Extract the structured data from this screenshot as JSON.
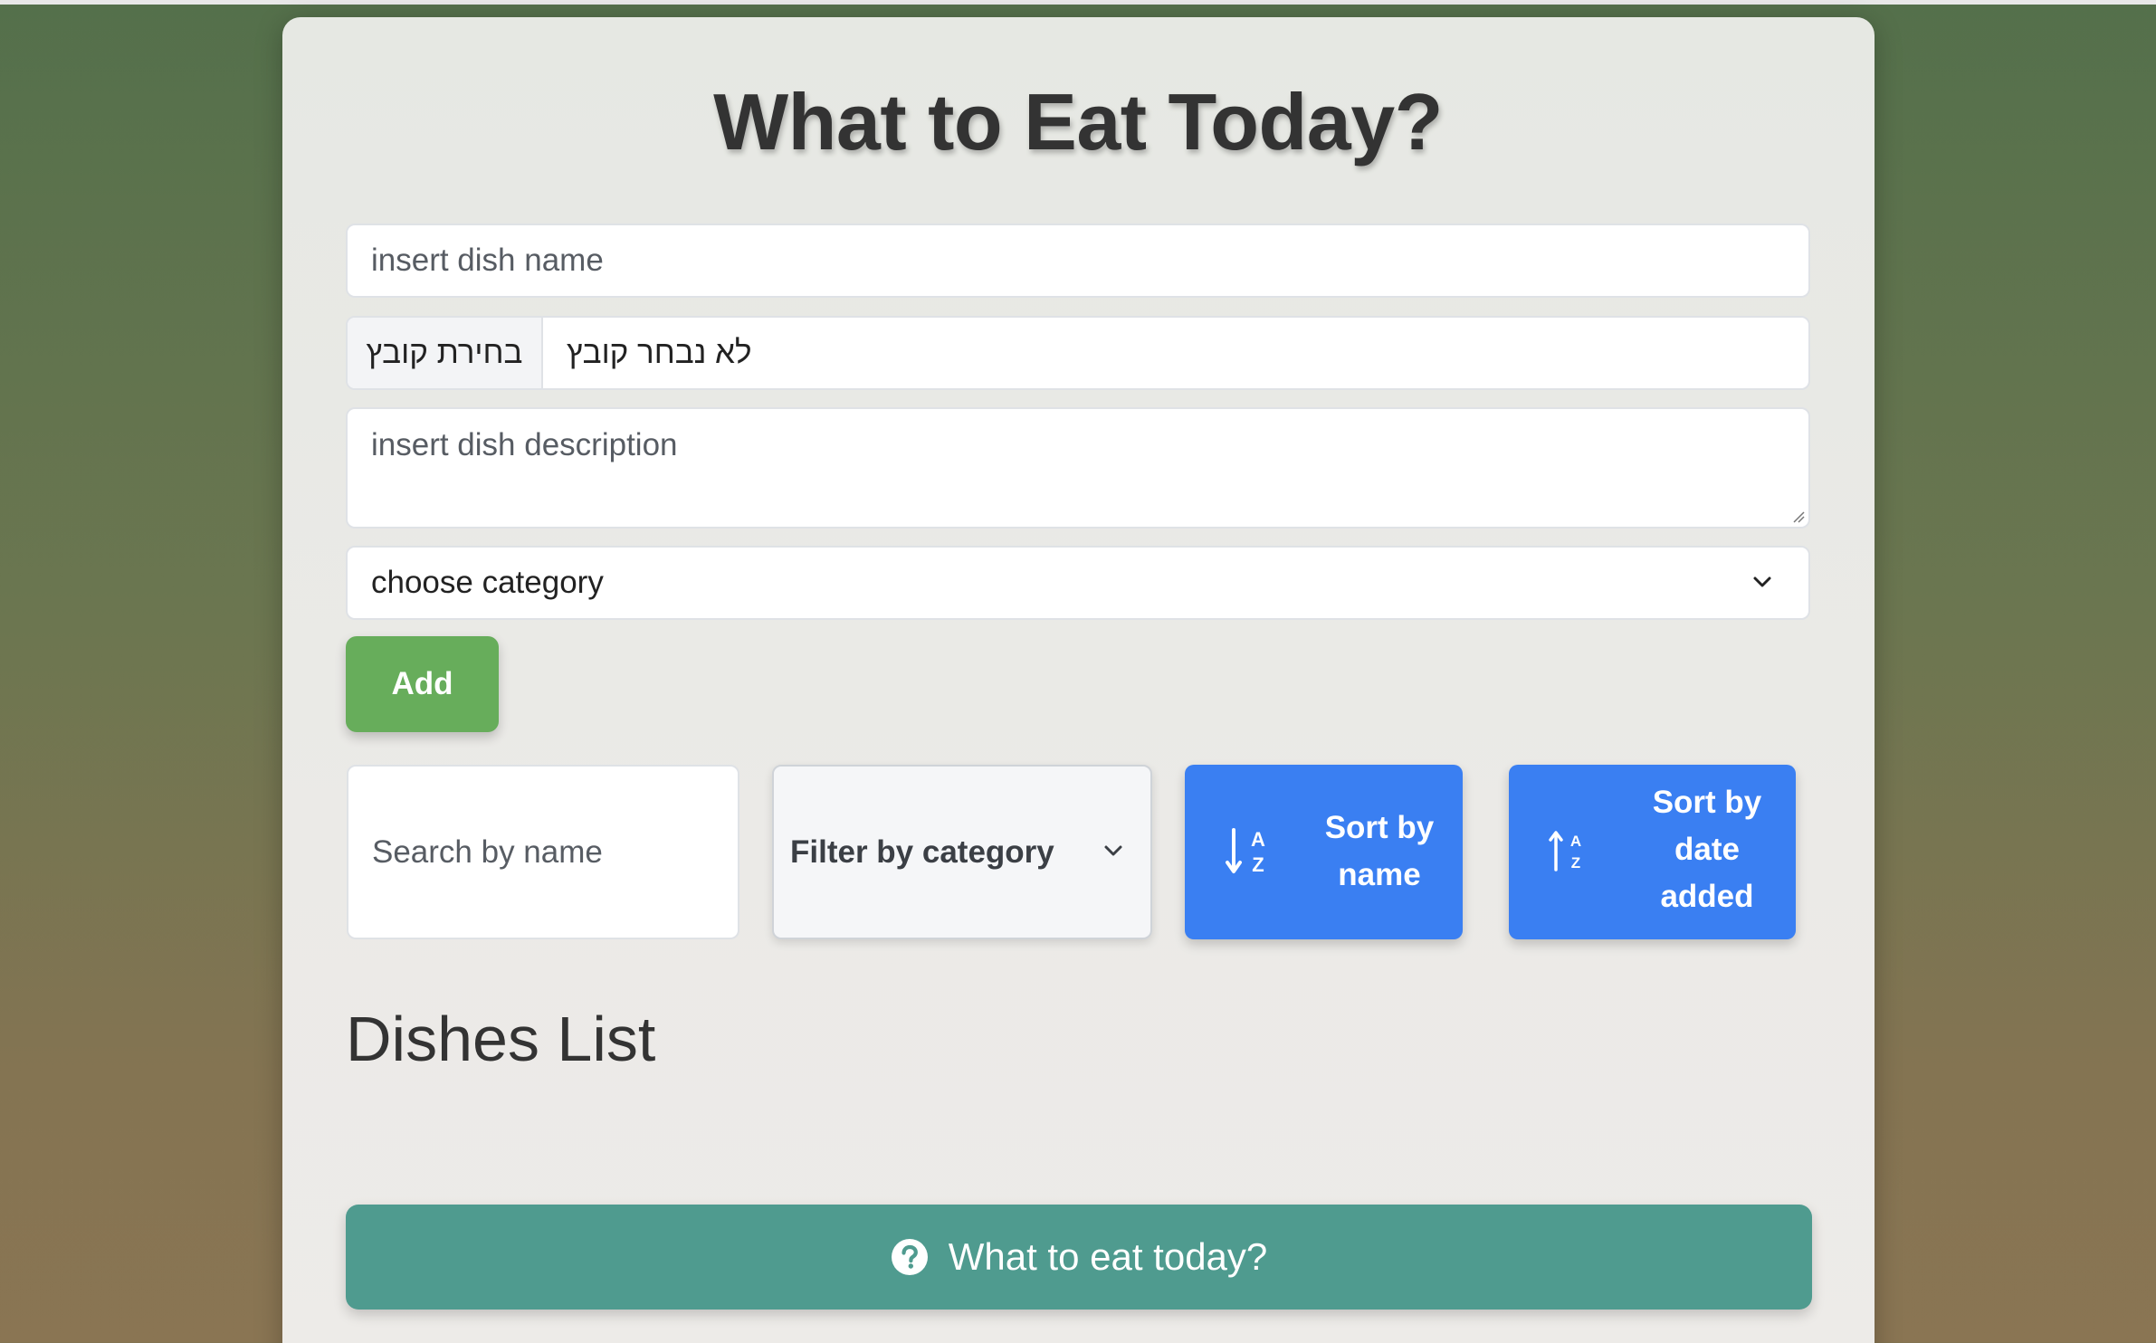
{
  "header": {
    "title": "What to Eat Today?"
  },
  "form": {
    "dish_name_placeholder": "insert dish name",
    "file_button_label": "בחירת קובץ",
    "file_status": "לא נבחר קובץ",
    "description_placeholder": "insert dish description",
    "category_selected": "choose category",
    "add_label": "Add"
  },
  "controls": {
    "search_placeholder": "Search by name",
    "filter_selected": "Filter by category",
    "sort_name_line1": "Sort by",
    "sort_name_line2": "name",
    "sort_date_line1": "Sort by",
    "sort_date_line2": "date",
    "sort_date_line3": "added",
    "sort_name_icon_letters": [
      "A",
      "Z"
    ],
    "sort_date_icon_letters": [
      "A",
      "Z"
    ]
  },
  "list": {
    "heading": "Dishes List",
    "items": []
  },
  "footer": {
    "random_label": "What to eat today?"
  },
  "icons": {
    "sort_name": "sort-alpha-down-icon",
    "sort_date": "sort-alpha-up-icon",
    "random": "question-circle-icon",
    "dropdown": "chevron-down-icon"
  },
  "colors": {
    "add_button": "#67ad5b",
    "sort_button": "#3a7ff2",
    "random_button": "#4f9b8f",
    "title_text": "#333333"
  }
}
